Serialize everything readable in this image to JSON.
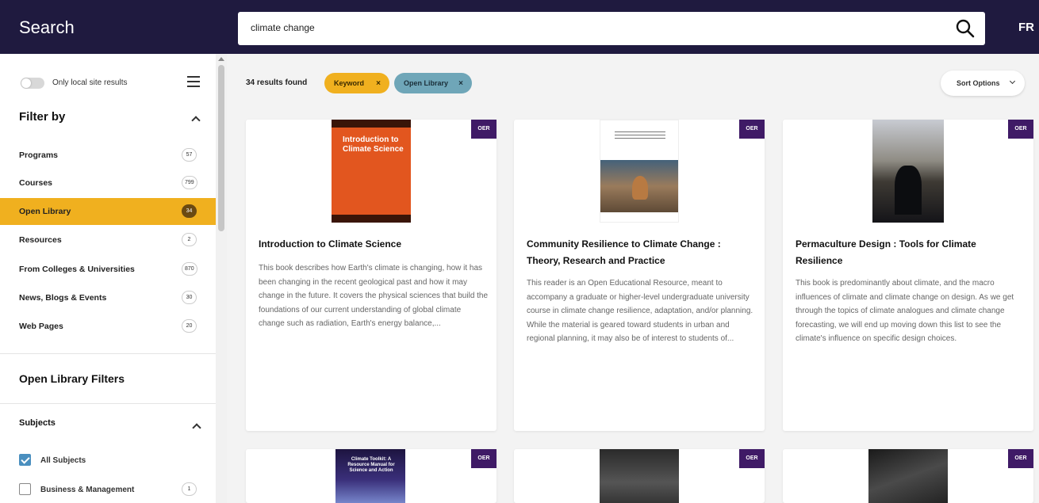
{
  "header": {
    "title": "Search",
    "search_value": "climate change",
    "language": "FR"
  },
  "sidebar": {
    "local_toggle_label": "Only local site results",
    "filter_by_title": "Filter by",
    "filters": [
      {
        "label": "Programs",
        "count": "57"
      },
      {
        "label": "Courses",
        "count": "799"
      },
      {
        "label": "Open Library",
        "count": "34",
        "active": true
      },
      {
        "label": "Resources",
        "count": "2"
      },
      {
        "label": "From Colleges & Universities",
        "count": "870"
      },
      {
        "label": "News, Blogs & Events",
        "count": "30"
      },
      {
        "label": "Web Pages",
        "count": "20"
      }
    ],
    "open_library_filters_title": "Open Library Filters",
    "subjects_title": "Subjects",
    "subjects": [
      {
        "label": "All Subjects",
        "checked": true
      },
      {
        "label": "Business & Management",
        "count": "1"
      }
    ]
  },
  "results": {
    "count_text": "34 results found",
    "chips": [
      {
        "label": "Keyword",
        "remove": "×"
      },
      {
        "label": "Open Library",
        "remove": "×"
      }
    ],
    "sort_label": "Sort Options"
  },
  "cards": [
    {
      "badge": "OER",
      "cover_title": "Introduction to Climate Science",
      "title": "Introduction to Climate Science",
      "description": "This book describes how Earth's climate is changing, how it has been changing in the recent geological past and how it may change in the future. It covers the physical sciences that build the foundations of our current understanding of global climate change such as radiation, Earth's energy balance,..."
    },
    {
      "badge": "OER",
      "title": "Community Resilience to Climate Change : Theory, Research and Practice",
      "description": "This reader is an Open Educational Resource, meant to accompany a graduate or higher-level undergraduate university course in climate change resilience, adaptation, and/or planning. While the material is geared toward students in urban and regional planning, it may also be of interest to students of..."
    },
    {
      "badge": "OER",
      "title": "Permaculture Design : Tools for Climate Resilience",
      "description": "This book is predominantly about climate, and the macro influences of climate and climate change on design. As we get through the topics of climate analogues and climate change forecasting, we will end up moving down this list to see the climate's influence on specific design choices."
    },
    {
      "badge": "OER",
      "cover_title": "Climate Toolkit: A Resource Manual for Science and Action"
    },
    {
      "badge": "OER"
    },
    {
      "badge": "OER"
    }
  ],
  "colors": {
    "header_bg": "#1f1a3f",
    "accent_yellow": "#f0b01f",
    "chip_blue": "#6fa6b8",
    "oer_badge": "#3f1a66"
  }
}
